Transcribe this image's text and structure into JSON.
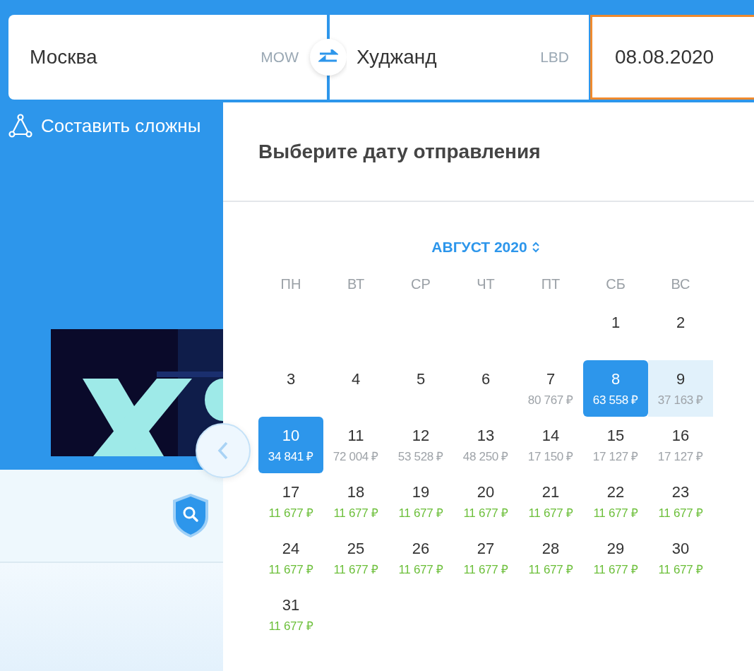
{
  "search_form": {
    "origin": {
      "city": "Москва",
      "code": "MOW"
    },
    "destination": {
      "city": "Худжанд",
      "code": "LBD"
    },
    "date": {
      "value": "08.08.2020",
      "focused": true
    }
  },
  "complex_route_link": "Составить сложны",
  "calendar": {
    "title": "Выберите дату отправления",
    "month": "АВГУСТ 2020",
    "weekdays": [
      "ПН",
      "ВТ",
      "СР",
      "ЧТ",
      "ПТ",
      "СБ",
      "ВС"
    ],
    "days": [
      {
        "day": "1",
        "selected": false,
        "highlighted": false
      },
      {
        "day": "2",
        "selected": false,
        "highlighted": false
      },
      {
        "day": "3",
        "selected": false,
        "highlighted": false
      },
      {
        "day": "4",
        "selected": false,
        "highlighted": false
      },
      {
        "day": "5",
        "selected": false,
        "highlighted": false
      },
      {
        "day": "6",
        "selected": false,
        "highlighted": false
      },
      {
        "day": "7",
        "price": "80 767 ₽",
        "cheap": false,
        "selected": false,
        "highlighted": false
      },
      {
        "day": "8",
        "price": "63 558 ₽",
        "cheap": false,
        "selected": true,
        "highlighted": false
      },
      {
        "day": "9",
        "price": "37 163 ₽",
        "cheap": false,
        "selected": false,
        "highlighted": true
      },
      {
        "day": "10",
        "price": "34 841 ₽",
        "cheap": false,
        "selected": true,
        "highlighted": false
      },
      {
        "day": "11",
        "price": "72 004 ₽",
        "cheap": false,
        "selected": false,
        "highlighted": false
      },
      {
        "day": "12",
        "price": "53 528 ₽",
        "cheap": false,
        "selected": false,
        "highlighted": false
      },
      {
        "day": "13",
        "price": "48 250 ₽",
        "cheap": false,
        "selected": false,
        "highlighted": false
      },
      {
        "day": "14",
        "price": "17 150 ₽",
        "cheap": false,
        "selected": false,
        "highlighted": false
      },
      {
        "day": "15",
        "price": "17 127 ₽",
        "cheap": false,
        "selected": false,
        "highlighted": false
      },
      {
        "day": "16",
        "price": "17 127 ₽",
        "cheap": false,
        "selected": false,
        "highlighted": false
      },
      {
        "day": "17",
        "price": "11 677 ₽",
        "cheap": true,
        "selected": false,
        "highlighted": false
      },
      {
        "day": "18",
        "price": "11 677 ₽",
        "cheap": true,
        "selected": false,
        "highlighted": false
      },
      {
        "day": "19",
        "price": "11 677 ₽",
        "cheap": true,
        "selected": false,
        "highlighted": false
      },
      {
        "day": "20",
        "price": "11 677 ₽",
        "cheap": true,
        "selected": false,
        "highlighted": false
      },
      {
        "day": "21",
        "price": "11 677 ₽",
        "cheap": true,
        "selected": false,
        "highlighted": false
      },
      {
        "day": "22",
        "price": "11 677 ₽",
        "cheap": true,
        "selected": false,
        "highlighted": false
      },
      {
        "day": "23",
        "price": "11 677 ₽",
        "cheap": true,
        "selected": false,
        "highlighted": false
      },
      {
        "day": "24",
        "price": "11 677 ₽",
        "cheap": true,
        "selected": false,
        "highlighted": false
      },
      {
        "day": "25",
        "price": "11 677 ₽",
        "cheap": true,
        "selected": false,
        "highlighted": false
      },
      {
        "day": "26",
        "price": "11 677 ₽",
        "cheap": true,
        "selected": false,
        "highlighted": false
      },
      {
        "day": "27",
        "price": "11 677 ₽",
        "cheap": true,
        "selected": false,
        "highlighted": false
      },
      {
        "day": "28",
        "price": "11 677 ₽",
        "cheap": true,
        "selected": false,
        "highlighted": false
      },
      {
        "day": "29",
        "price": "11 677 ₽",
        "cheap": true,
        "selected": false,
        "highlighted": false
      },
      {
        "day": "30",
        "price": "11 677 ₽",
        "cheap": true,
        "selected": false,
        "highlighted": false
      },
      {
        "day": "31",
        "price": "11 677 ₽",
        "cheap": true,
        "selected": false,
        "highlighted": false
      }
    ]
  }
}
